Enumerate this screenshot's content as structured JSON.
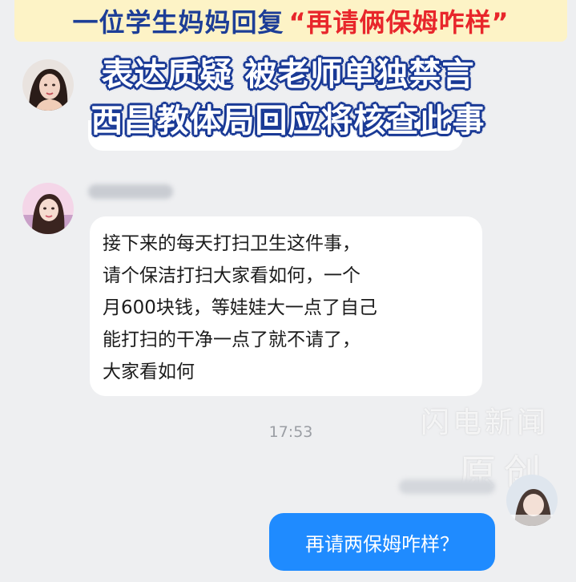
{
  "banner": {
    "title_plain": "一位学生妈妈回复",
    "title_highlight": "“再请俩保姆咋样”",
    "caption_line1": "表达质疑 被老师单独禁言",
    "caption_line2": "西昌教体局回应将核查此事"
  },
  "chat": {
    "messages": [
      {
        "sender": "other",
        "lines": [
          "接下来的每天打扫卫生这件事，",
          "请个保洁打扫大家看如何，一个",
          "月600块钱，等娃娃大一点了自己",
          "能打扫的干净一点了就不请了，",
          "大家看如何"
        ]
      },
      {
        "sender": "self",
        "text": "再请两保姆咋样？"
      }
    ],
    "timestamp": "17:53"
  },
  "watermark": {
    "line1": "闪电新闻",
    "line2": "原创"
  },
  "colors": {
    "background": "#eeeff1",
    "bubble_incoming": "#ffffff",
    "bubble_outgoing": "#1f8bff",
    "banner_bg": "#fdf3c6",
    "banner_text": "#1d3e97",
    "banner_highlight": "#e8262b",
    "caption_outline": "#1a3a96"
  }
}
